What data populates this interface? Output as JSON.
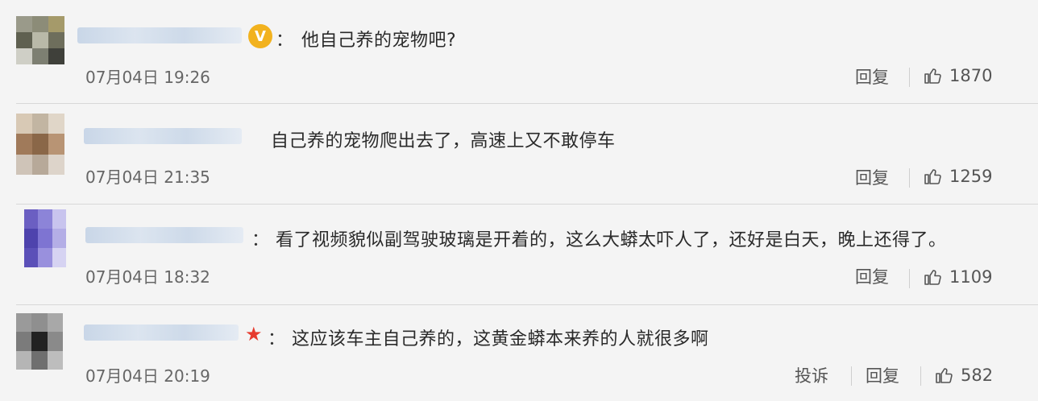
{
  "comments": [
    {
      "badge": "v-icon",
      "colon": "：",
      "text": "他自己养的宠物吧?",
      "time": "07月04日 19:26",
      "reply": "回复",
      "likes": "1870"
    },
    {
      "badge": "none",
      "colon": "",
      "text": "自己养的宠物爬出去了，高速上又不敢停车",
      "time": "07月04日 21:35",
      "reply": "回复",
      "likes": "1259"
    },
    {
      "badge": "none",
      "colon": "：",
      "text": "看了视频貌似副驾驶玻璃是开着的，这么大蟒太吓人了，还好是白天，晚上还得了。",
      "time": "07月04日 18:32",
      "reply": "回复",
      "likes": "1109"
    },
    {
      "badge": "star-icon",
      "colon": "：",
      "text": "这应该车主自己养的，这黄金蟒本来养的人就很多啊",
      "time": "07月04日 20:19",
      "report": "投诉",
      "reply": "回复",
      "likes": "582"
    }
  ],
  "colors": {
    "background": "#f4f4f4",
    "v_badge": "#f2b21e",
    "star_badge": "#e63b2e"
  }
}
